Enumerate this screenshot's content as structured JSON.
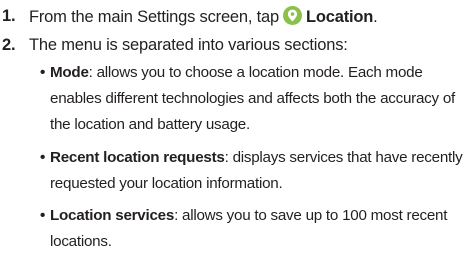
{
  "steps": [
    {
      "number": "1.",
      "text_before": "From the main Settings screen, tap",
      "icon": "location-pin-icon",
      "icon_color": "#8ac249",
      "bold_label": "Location",
      "text_after": "."
    },
    {
      "number": "2.",
      "text": "The menu is separated into various sections:"
    }
  ],
  "bullets": [
    {
      "term": "Mode",
      "line1_rest": ": allows you to choose a location mode. Each mode",
      "line2": "enables different technologies and affects both the accuracy of",
      "line3": "the location and battery usage."
    },
    {
      "term": "Recent location requests",
      "line1_rest": ": displays services that have recently",
      "line2": "requested your location information."
    },
    {
      "term": "Location services",
      "line1_rest": ": allows you to save up to 100 most recent",
      "line2": "locations."
    }
  ]
}
